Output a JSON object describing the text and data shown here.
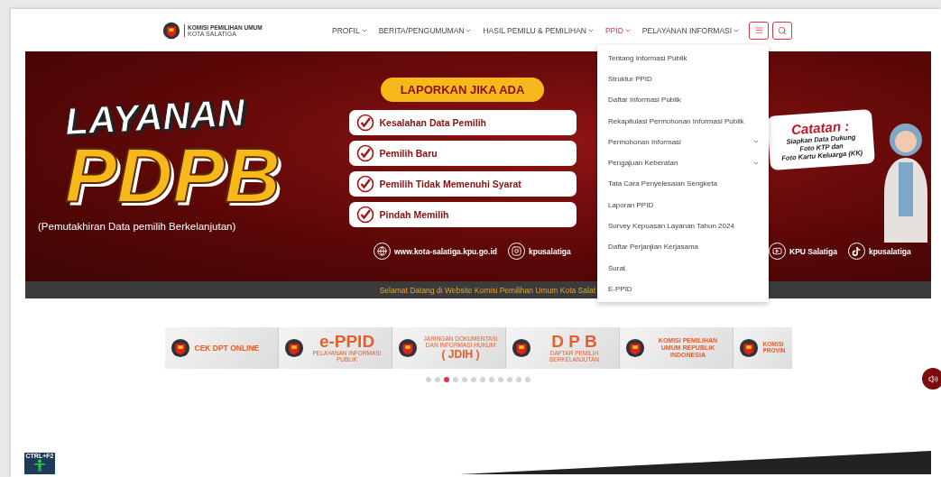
{
  "header": {
    "logo": {
      "line1": "KOMISI PEMILIHAN UMUM",
      "line2": "KOTA SALATIGA"
    },
    "nav": [
      {
        "label": "PROFIL",
        "selected": false,
        "expanded": false
      },
      {
        "label": "BERITA/PENGUMUMAN",
        "selected": false,
        "expanded": false
      },
      {
        "label": "HASIL PEMILU & PEMILIHAN",
        "selected": false,
        "expanded": false
      },
      {
        "label": "PPID",
        "selected": true,
        "expanded": true
      },
      {
        "label": "PELAYANAN INFORMASI",
        "selected": false,
        "expanded": false
      }
    ]
  },
  "ppid_menu": [
    {
      "label": "Tentang Informasi Publik",
      "has_submenu": false
    },
    {
      "label": "Struktur PPID",
      "has_submenu": false
    },
    {
      "label": "Daftar Informasi Publik",
      "has_submenu": false
    },
    {
      "label": "Rekapitulasi Permohonan Informasi Publik",
      "has_submenu": false
    },
    {
      "label": "Permohonan Informasi",
      "has_submenu": true
    },
    {
      "label": "Pengajuan Keberatan",
      "has_submenu": true
    },
    {
      "label": "Tata Cara Penyelesaian Sengketa",
      "has_submenu": false
    },
    {
      "label": "Laporan PPID",
      "has_submenu": false
    },
    {
      "label": "Survey Kepuasan Layanan Tahun 2024",
      "has_submenu": false
    },
    {
      "label": "Daftar Perjanjian Kerjasama",
      "has_submenu": false
    },
    {
      "label": "Surat",
      "has_submenu": false
    },
    {
      "label": "E-PPID",
      "has_submenu": false
    }
  ],
  "banner": {
    "title": "LAYANAN",
    "headline": "PDPB",
    "subtitle": "(Pemutakhiran Data pemilih Berkelanjutan)",
    "report_heading": "LAPORKAN JIKA ADA",
    "report_items": [
      "Kesalahan Data Pemilih",
      "Pemilih Baru",
      "Pemilih Tidak Memenuhi Syarat",
      "Pindah Memilih"
    ],
    "links": [
      {
        "kind": "web",
        "label": "www.kota-salatiga.kpu.go.id"
      },
      {
        "kind": "instagram",
        "label": "kpusalatiga"
      },
      {
        "kind": "youtube",
        "label": "KPU Salatiga"
      },
      {
        "kind": "tiktok",
        "label": "kpusalatiga"
      }
    ],
    "note": {
      "title": "Catatan :",
      "lines": [
        "Siapkan Data Dukung",
        "Foto KTP dan",
        "Foto Kartu Keluarga (KK)"
      ]
    }
  },
  "marquee": "Selamat Datang di Website Komisi Pemilihan Umum Kota Salat",
  "carousel": [
    {
      "kind": "plain",
      "title": "CEK DPT ONLINE"
    },
    {
      "kind": "stacked",
      "title": "e-PPID",
      "sub": "PELAYANAN INFORMASI PUBLIK"
    },
    {
      "kind": "jdih",
      "title": "( JDIH )",
      "sub": "JARINGAN DOKUMENTASI DAN INFORMASI HUKUM"
    },
    {
      "kind": "stacked",
      "title": "D P B",
      "sub": "DAFTAR PEMILIH BERKELANJUTAN"
    },
    {
      "kind": "plain",
      "title": "KOMISI PEMILIHAN UMUM REPUBLIK INDONESIA"
    },
    {
      "kind": "plain",
      "title": "KOMISI PROVIN"
    }
  ],
  "carousel_dots": [
    {
      "selected": false
    },
    {
      "selected": false
    },
    {
      "selected": true
    },
    {
      "selected": false
    },
    {
      "selected": false
    },
    {
      "selected": false
    },
    {
      "selected": false
    },
    {
      "selected": false
    },
    {
      "selected": false
    },
    {
      "selected": false
    },
    {
      "selected": false
    },
    {
      "selected": false
    }
  ],
  "accessibility_badge": "CTRL+F2"
}
